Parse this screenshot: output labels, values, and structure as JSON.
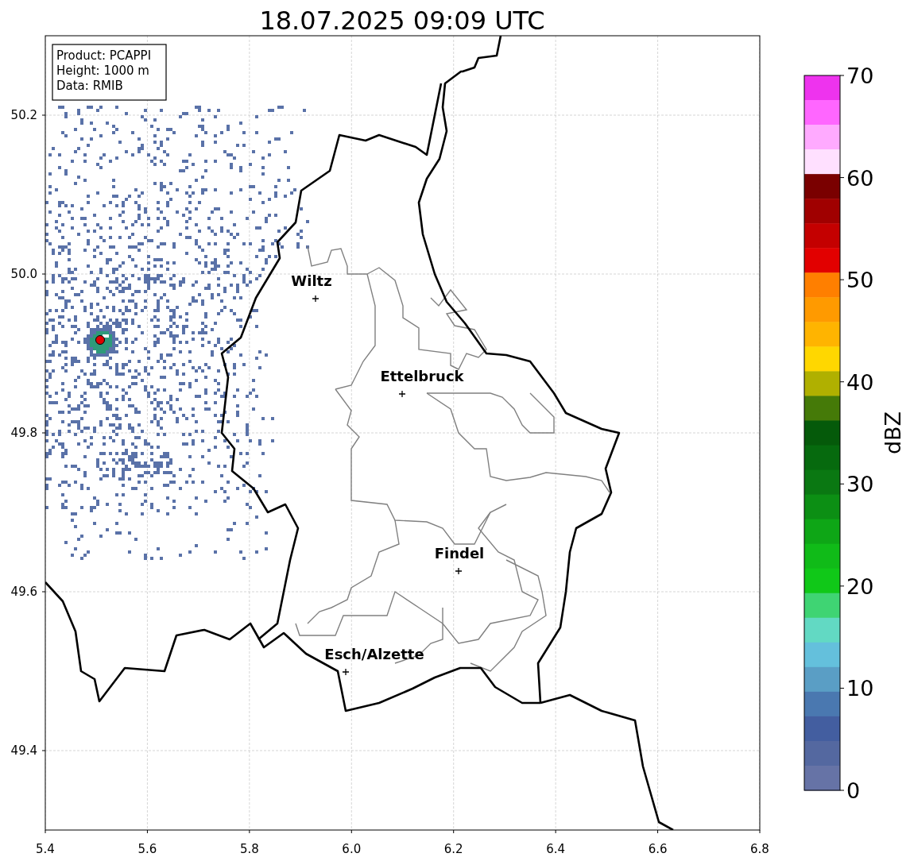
{
  "title": "18.07.2025 09:09 UTC",
  "info_box": [
    "Product: PCAPPI",
    "Height: 1000 m",
    "Data: RMIB"
  ],
  "map": {
    "cities": [
      {
        "name": "Wiltz"
      },
      {
        "name": "Ettelbruck"
      },
      {
        "name": "Findel"
      },
      {
        "name": "Esch/Alzette"
      }
    ],
    "x_ticks": [
      "5.4",
      "5.6",
      "5.8",
      "6.0",
      "6.2",
      "6.4",
      "6.6",
      "6.8"
    ],
    "y_ticks": [
      "50.2",
      "50.0",
      "49.8",
      "49.6",
      "49.4"
    ]
  },
  "colorbar": {
    "label": "dBZ",
    "ticks": [
      "70",
      "60",
      "50",
      "40",
      "30",
      "20",
      "10",
      "0"
    ],
    "bands": [
      {
        "color": "#ee33ee"
      },
      {
        "color": "#ff66ff"
      },
      {
        "color": "#ffaaff"
      },
      {
        "color": "#ffe0ff"
      },
      {
        "color": "#7a0000"
      },
      {
        "color": "#a00000"
      },
      {
        "color": "#c40000"
      },
      {
        "color": "#e20000"
      },
      {
        "color": "#ff7f00"
      },
      {
        "color": "#ff9a00"
      },
      {
        "color": "#ffb400"
      },
      {
        "color": "#ffd700"
      },
      {
        "color": "#b0b000"
      },
      {
        "color": "#457a08"
      },
      {
        "color": "#055a0a"
      },
      {
        "color": "#066a0e"
      },
      {
        "color": "#0a7812"
      },
      {
        "color": "#0c8f14"
      },
      {
        "color": "#0ea616"
      },
      {
        "color": "#10bb18"
      },
      {
        "color": "#10c818"
      },
      {
        "color": "#3fd473"
      },
      {
        "color": "#62d9c3"
      },
      {
        "color": "#64c0dc"
      },
      {
        "color": "#5a9ec5"
      },
      {
        "color": "#4a78b0"
      },
      {
        "color": "#435ea0"
      },
      {
        "color": "#5468a0"
      },
      {
        "color": "#6673a6"
      }
    ]
  }
}
